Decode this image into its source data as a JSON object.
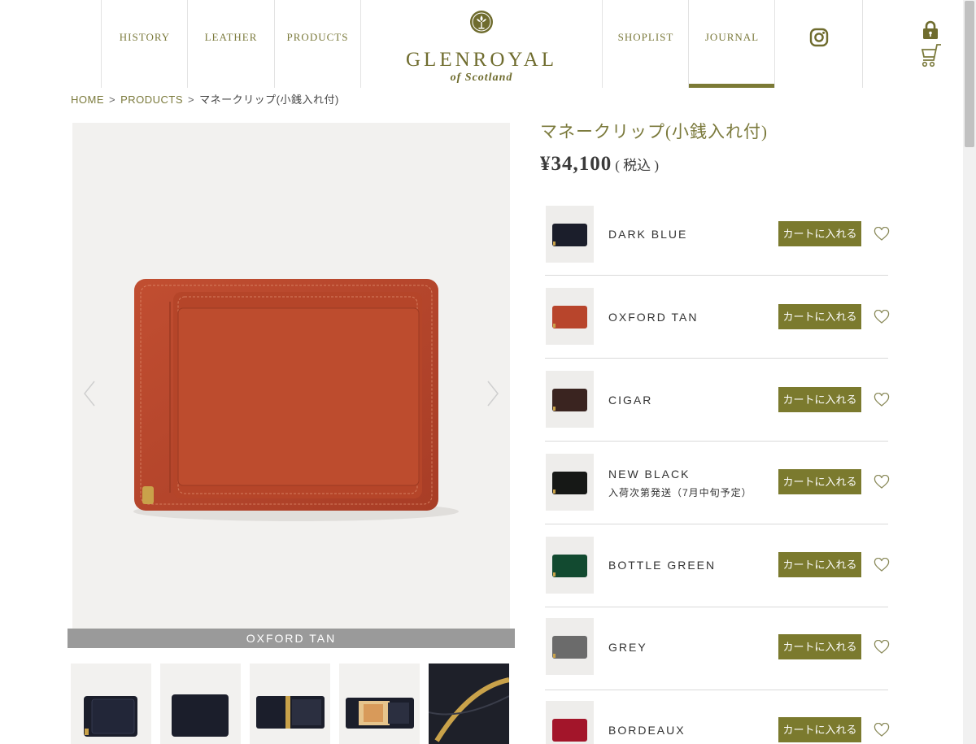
{
  "nav": {
    "history": "HISTORY",
    "leather": "LEATHER",
    "products": "PRODUCTS",
    "shoplist": "SHOPLIST",
    "journal": "JOURNAL"
  },
  "logo": {
    "name": "GLENROYAL",
    "sub": "of Scotland"
  },
  "breadcrumb": {
    "home": "HOME",
    "sep": ">",
    "products": "PRODUCTS",
    "current": "マネークリップ(小銭入れ付)"
  },
  "product": {
    "title": "マネークリップ(小銭入れ付)",
    "price": "¥34,100",
    "tax": "( 税込 )"
  },
  "gallery": {
    "caption": "OXFORD TAN"
  },
  "cart_label": "カートに入れる",
  "variants": [
    {
      "name": "DARK BLUE",
      "note": ""
    },
    {
      "name": "OXFORD TAN",
      "note": ""
    },
    {
      "name": "CIGAR",
      "note": ""
    },
    {
      "name": "NEW BLACK",
      "note": "入荷次第発送（7月中旬予定）"
    },
    {
      "name": "BOTTLE GREEN",
      "note": ""
    },
    {
      "name": "GREY",
      "note": ""
    },
    {
      "name": "BORDEAUX",
      "note": ""
    }
  ],
  "colors": {
    "accent": "#7b7a2e",
    "caption_bg": "#9a9a9a",
    "dark_blue": "#1b1e2b",
    "oxford_tan": "#b8452c",
    "cigar": "#3a2420",
    "new_black": "#161816",
    "bottle_green": "#124a30",
    "grey": "#6b6b6b",
    "bordeaux": "#a3152a"
  },
  "icons": {
    "lock": "lock-icon",
    "cart": "cart-icon",
    "instagram": "instagram-icon",
    "favorite": "heart-icon",
    "prev": "chevron-left-icon",
    "next": "chevron-right-icon"
  }
}
